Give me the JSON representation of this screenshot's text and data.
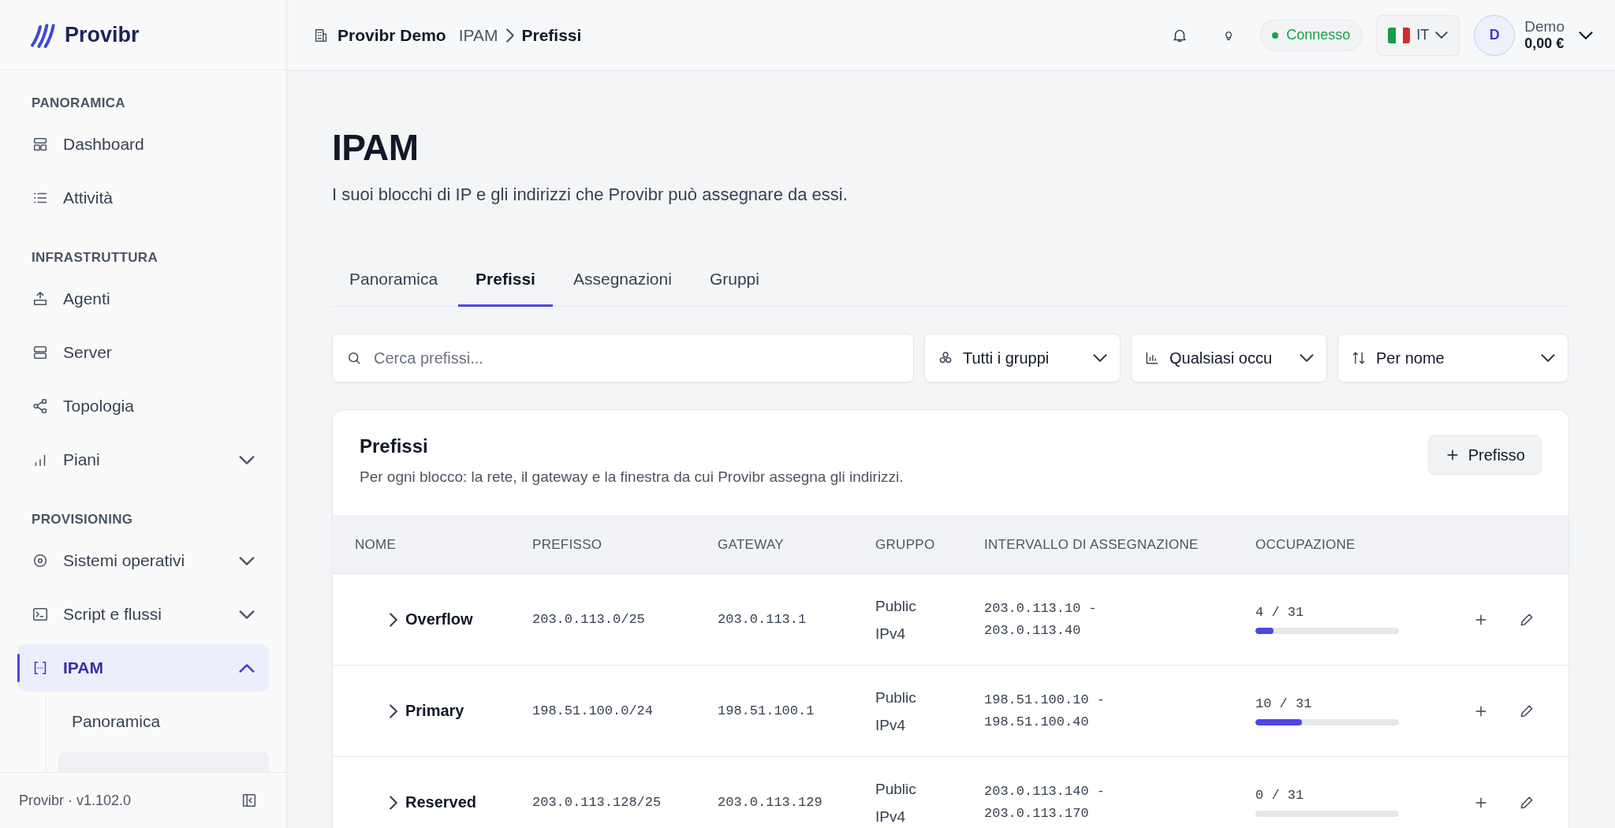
{
  "sidebar": {
    "logo": "Provibr",
    "sections": [
      {
        "title": "PANORAMICA",
        "items": [
          {
            "label": "Dashboard",
            "kind": "link",
            "selected": false
          },
          {
            "label": "Attività",
            "kind": "link",
            "selected": false
          }
        ]
      },
      {
        "title": "INFRASTRUTTURA",
        "items": [
          {
            "label": "Agenti",
            "kind": "link",
            "selected": false
          },
          {
            "label": "Server",
            "kind": "link",
            "selected": false
          },
          {
            "label": "Topologia",
            "kind": "link",
            "selected": false
          },
          {
            "label": "Piani",
            "kind": "group",
            "expanded": false,
            "selected": false
          }
        ]
      },
      {
        "title": "PROVISIONING",
        "items": [
          {
            "label": "Sistemi operativi",
            "kind": "group",
            "expanded": false,
            "selected": false
          },
          {
            "label": "Script e flussi",
            "kind": "group",
            "expanded": false,
            "selected": false
          },
          {
            "label": "IPAM",
            "kind": "group",
            "expanded": true,
            "selected": true,
            "children": [
              {
                "label": "Panoramica",
                "selected": false
              },
              {
                "selected": true
              }
            ]
          }
        ]
      }
    ],
    "version": "Provibr · v1.102.0"
  },
  "header": {
    "workspace": "Provibr Demo",
    "breadcrumb": [
      "IPAM",
      "Prefissi"
    ],
    "status": {
      "label": "Connesso",
      "color": "#16a34a"
    },
    "language": "IT",
    "user": {
      "initial": "D",
      "name": "Demo",
      "balance": "0,00 €"
    }
  },
  "page": {
    "title": "IPAM",
    "subtitle": "I suoi blocchi di IP e gli indirizzi che Provibr può assegnare da essi.",
    "tabs": [
      {
        "label": "Panoramica",
        "selected": false
      },
      {
        "label": "Prefissi",
        "selected": true
      },
      {
        "label": "Assegnazioni",
        "selected": false
      },
      {
        "label": "Gruppi",
        "selected": false
      }
    ],
    "filters": {
      "search": {
        "placeholder": "Cerca prefissi..."
      },
      "dropdowns": [
        "Tutti i gruppi",
        "Qualsiasi occu",
        "Per nome"
      ]
    },
    "card": {
      "title": "Prefissi",
      "description": "Per ogni blocco: la rete, il gateway e la finestra da cui Provibr assegna gli indirizzi.",
      "button": "Prefisso",
      "table": {
        "columns": [
          "NOME",
          "PREFISSO",
          "GATEWAY",
          "GRUPPO",
          "INTERVALLO DI ASSEGNAZIONE",
          "OCCUPAZIONE"
        ],
        "rows": [
          {
            "name": "Overflow",
            "expanded": false,
            "prefix": "203.0.113.0/25",
            "gateway": "203.0.113.1",
            "group": "Public IPv4",
            "range": "203.0.113.10 - 203.0.113.40",
            "occupancy": "4 / 31",
            "level": 0.129
          },
          {
            "name": "Primary",
            "expanded": false,
            "prefix": "198.51.100.0/24",
            "gateway": "198.51.100.1",
            "group": "Public IPv4",
            "range": "198.51.100.10 - 198.51.100.40",
            "occupancy": "10 / 31",
            "level": 0.323
          },
          {
            "name": "Reserved",
            "expanded": false,
            "prefix": "203.0.113.128/25",
            "gateway": "203.0.113.129",
            "group": "Public IPv4",
            "range": "203.0.113.140 - 203.0.113.170",
            "occupancy": "0 / 31",
            "level": 0
          }
        ]
      }
    }
  }
}
